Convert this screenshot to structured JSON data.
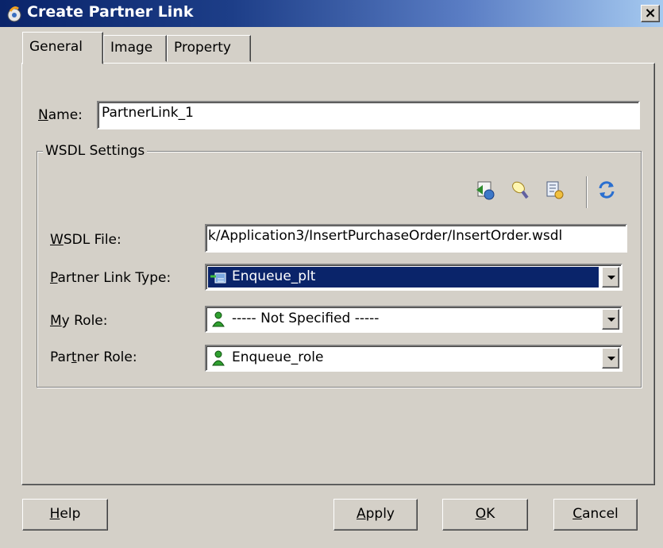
{
  "window": {
    "title": "Create Partner Link",
    "close_label": "×"
  },
  "tabs": [
    {
      "label": "General"
    },
    {
      "label": "Image"
    },
    {
      "label": "Property"
    }
  ],
  "general": {
    "name_label_prefix": "N",
    "name_label_rest": "ame:",
    "name_value": "PartnerLink_1",
    "wsdl_group_title": "WSDL Settings",
    "toolbar_icons": [
      "browse-service-explorer-icon",
      "find-partner-link-icon",
      "service-explorer-icon",
      "refresh-icon"
    ],
    "wsdl_file_label_prefix": "W",
    "wsdl_file_label_rest": "SDL File:",
    "wsdl_file_value": "k/Application3/InsertPurchaseOrder/InsertOrder.wsdl",
    "partner_link_type_label_prefix": "P",
    "partner_link_type_label_rest": "artner Link Type:",
    "partner_link_type_value": "Enqueue_plt",
    "my_role_label_prefix": "M",
    "my_role_label_rest": "y Role:",
    "my_role_value": "----- Not Specified -----",
    "partner_role_label_a": "Par",
    "partner_role_label_u": "t",
    "partner_role_label_b": "ner Role:",
    "partner_role_value": "Enqueue_role"
  },
  "buttons": {
    "help_u": "H",
    "help_rest": "elp",
    "apply_u": "A",
    "apply_rest": "pply",
    "ok_u": "O",
    "ok_rest": "K",
    "cancel_u": "C",
    "cancel_rest": "ancel"
  },
  "colors": {
    "dialog_bg": "#d4d0c8",
    "selection": "#0a246a"
  }
}
